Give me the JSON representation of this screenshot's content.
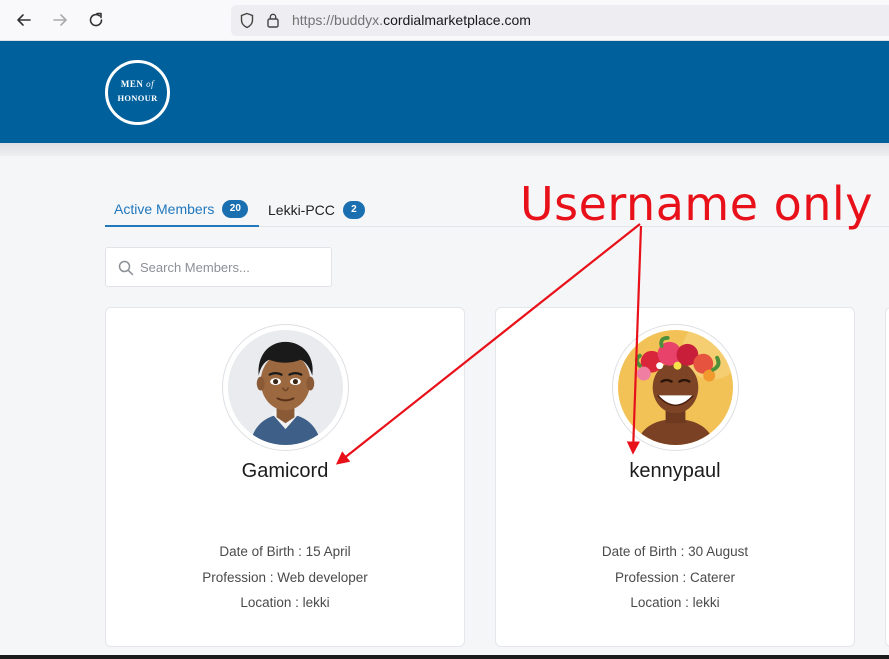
{
  "browser": {
    "url_prefix": "https://",
    "url_sub": "buddyx.",
    "url_domain": "cordialmarketplace.com"
  },
  "header": {
    "logo_line1_a": "MEN",
    "logo_line1_b": "of",
    "logo_line2": "HONOUR",
    "background_color": "#00609c"
  },
  "tabs": [
    {
      "label": "Active Members",
      "count": "20",
      "active": true
    },
    {
      "label": "Lekki-PCC",
      "count": "2",
      "active": false
    }
  ],
  "search": {
    "placeholder": "Search Members..."
  },
  "members": [
    {
      "name": "Gamicord",
      "dob": "Date of Birth : 15 April",
      "profession": "Profession : Web developer",
      "location": "Location : lekki",
      "avatar_icon": "cartoon-man-avatar"
    },
    {
      "name": "kennypaul",
      "dob": "Date of Birth : 30 August",
      "profession": "Profession : Caterer",
      "location": "Location : lekki",
      "avatar_icon": "woman-flower-crown-avatar"
    }
  ],
  "annotation": {
    "text": "Username only",
    "color": "#e8111a"
  }
}
